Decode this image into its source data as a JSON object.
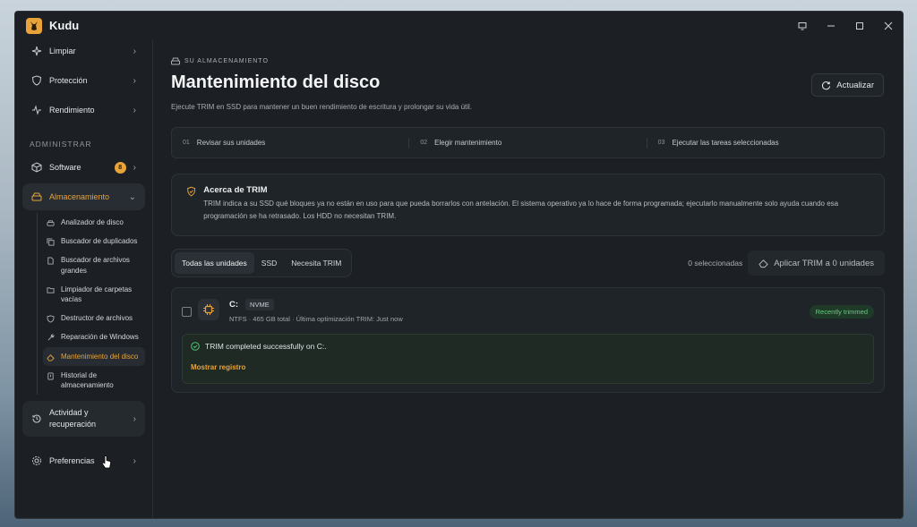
{
  "app": {
    "title": "Kudu"
  },
  "window_controls": [
    "monitor-icon",
    "minimize-icon",
    "maximize-icon",
    "close-icon"
  ],
  "sidebar": {
    "top_items": [
      {
        "label": "Limpiar",
        "icon": "sparkles-icon"
      },
      {
        "label": "Protección",
        "icon": "shield-icon"
      },
      {
        "label": "Rendimiento",
        "icon": "activity-icon"
      }
    ],
    "section_label": "ADMINISTRAR",
    "software": {
      "label": "Software",
      "badge": "8"
    },
    "storage": {
      "label": "Almacenamiento"
    },
    "sub_items": [
      {
        "label": "Analizador de disco",
        "icon": "disk-icon"
      },
      {
        "label": "Buscador de duplicados",
        "icon": "copy-icon"
      },
      {
        "label": "Buscador de archivos grandes",
        "icon": "file-icon"
      },
      {
        "label": "Limpiador de carpetas vacías",
        "icon": "folder-icon"
      },
      {
        "label": "Destructor de archivos",
        "icon": "shred-icon"
      },
      {
        "label": "Reparación de Windows",
        "icon": "wrench-icon"
      },
      {
        "label": "Mantenimiento del disco",
        "icon": "eraser-icon",
        "active": true
      },
      {
        "label": "Historial de almacenamiento",
        "icon": "history-icon"
      }
    ],
    "activity": {
      "label": "Actividad y recuperación"
    },
    "preferences": {
      "label": "Preferencias"
    }
  },
  "main": {
    "eyebrow": "SU ALMACENAMIENTO",
    "title": "Mantenimiento del disco",
    "description": "Ejecute TRIM en SSD para mantener un buen rendimiento de escritura y prolongar su vida útil.",
    "refresh_label": "Actualizar",
    "steps": [
      {
        "num": "01",
        "label": "Revisar sus unidades"
      },
      {
        "num": "02",
        "label": "Elegir mantenimiento"
      },
      {
        "num": "03",
        "label": "Ejecutar las tareas seleccionadas"
      }
    ],
    "info": {
      "title": "Acerca de TRIM",
      "text": "TRIM indica a su SSD qué bloques ya no están en uso para que pueda borrarlos con antelación. El sistema operativo ya lo hace de forma programada; ejecutarlo manualmente solo ayuda cuando esa programación se ha retrasado. Los HDD no necesitan TRIM."
    },
    "filters": [
      "Todas las unidades",
      "SSD",
      "Necesita TRIM"
    ],
    "selected_count": "0 seleccionadas",
    "apply_label": "Aplicar TRIM a 0 unidades",
    "drive": {
      "name": "C:",
      "type": "NVME",
      "fs": "NTFS",
      "size": "465 GB total",
      "last_opt": "Última optimización TRIM: Just now",
      "status": "Recently trimmed",
      "success_message": "TRIM completed successfully on C:.",
      "log_link": "Mostrar registro"
    }
  },
  "colors": {
    "accent": "#e8a33a",
    "success": "#5fd07f",
    "background": "#1c2024"
  }
}
